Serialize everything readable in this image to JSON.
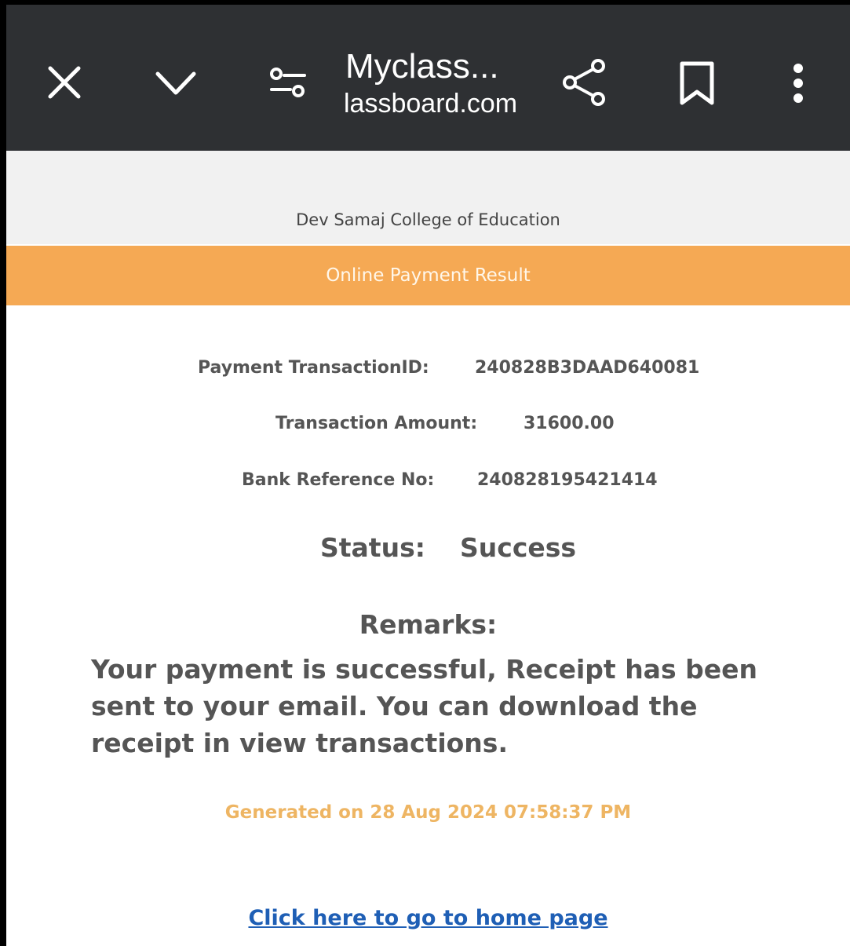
{
  "browser": {
    "title": "Myclass...",
    "url": "lassboard.com",
    "icons": {
      "close": "close-icon",
      "collapse": "chevron-down-icon",
      "settings": "tune-icon",
      "share": "share-icon",
      "bookmark": "bookmark-icon",
      "menu": "more-vertical-icon"
    }
  },
  "page": {
    "college_name": "Dev Samaj College of Education",
    "banner": "Online Payment Result",
    "fields": {
      "transaction_id_label": "Payment TransactionID:",
      "transaction_id_value": "240828B3DAAD640081",
      "amount_label": "Transaction Amount:",
      "amount_value": "31600.00",
      "bank_ref_label": "Bank Reference No:",
      "bank_ref_value": "240828195421414",
      "status_label": "Status:",
      "status_value": "Success"
    },
    "remarks_label": "Remarks:",
    "remarks_text": "Your payment is successful, Receipt has been sent to your email. You can download the receipt in view transactions.",
    "generated": "Generated on 28 Aug 2024 07:58:37 PM",
    "home_link": "Click here to go to home page"
  },
  "colors": {
    "topbar": "#2e3033",
    "banner": "#f5a954",
    "generated_text": "#eeb563",
    "link": "#1f5fb5"
  }
}
